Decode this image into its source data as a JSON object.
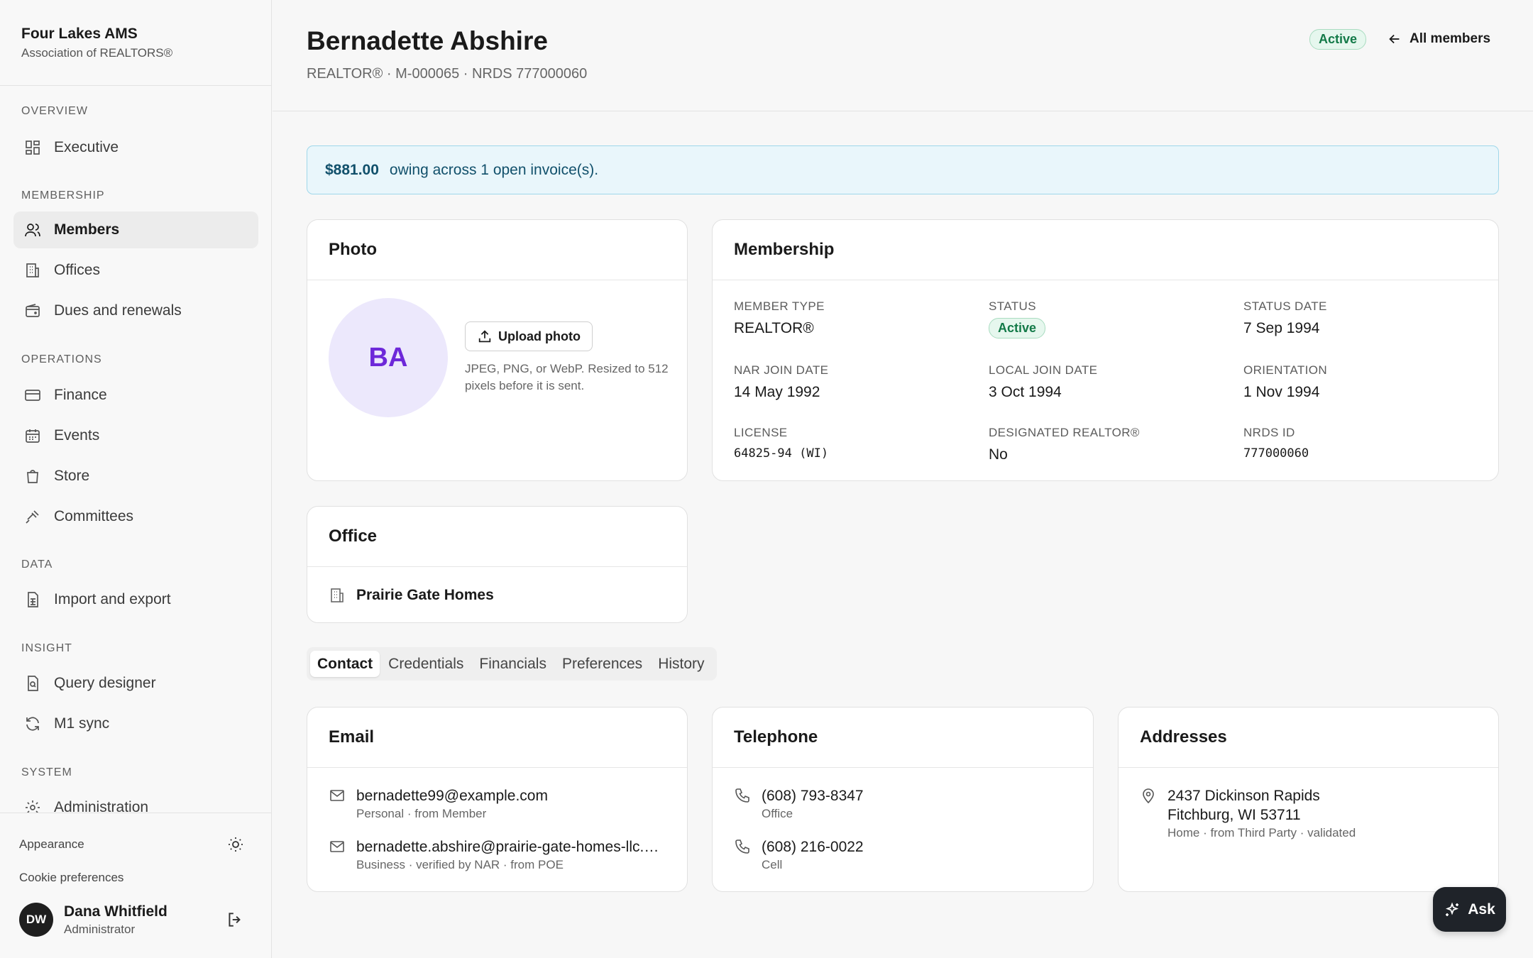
{
  "brand": {
    "name": "Four Lakes AMS",
    "sub": "Association of REALTORS®"
  },
  "nav": {
    "sections": {
      "overview": "OVERVIEW",
      "membership": "MEMBERSHIP",
      "operations": "OPERATIONS",
      "data": "DATA",
      "insight": "INSIGHT",
      "system": "SYSTEM"
    },
    "items": {
      "executive": "Executive",
      "members": "Members",
      "offices": "Offices",
      "dues": "Dues and renewals",
      "finance": "Finance",
      "events": "Events",
      "store": "Store",
      "committees": "Committees",
      "import_export": "Import and export",
      "query_designer": "Query designer",
      "m1_sync": "M1 sync",
      "administration": "Administration"
    }
  },
  "sidebar_footer": {
    "appearance": "Appearance",
    "cookie": "Cookie preferences",
    "user_initials": "DW",
    "user_name": "Dana Whitfield",
    "user_role": "Administrator"
  },
  "header": {
    "title": "Bernadette Abshire",
    "subtitle": "REALTOR® · M-000065 · NRDS 777000060",
    "status_badge": "Active",
    "back_label": "All members"
  },
  "alert": {
    "amount": "$881.00",
    "text": "owing across 1 open invoice(s)."
  },
  "photo_card": {
    "title": "Photo",
    "initials": "BA",
    "upload_label": "Upload photo",
    "hint": "JPEG, PNG, or WebP. Resized to 512 pixels before it is sent."
  },
  "membership_card": {
    "title": "Membership",
    "member_type_label": "MEMBER TYPE",
    "member_type": "REALTOR®",
    "status_label": "STATUS",
    "status": "Active",
    "status_date_label": "STATUS DATE",
    "status_date": "7 Sep 1994",
    "nar_join_label": "NAR JOIN DATE",
    "nar_join": "14 May 1992",
    "local_join_label": "LOCAL JOIN DATE",
    "local_join": "3 Oct 1994",
    "orientation_label": "ORIENTATION",
    "orientation": "1 Nov 1994",
    "license_label": "LICENSE",
    "license": "64825-94 (WI)",
    "designated_label": "DESIGNATED REALTOR®",
    "designated": "No",
    "nrds_label": "NRDS ID",
    "nrds": "777000060"
  },
  "office_card": {
    "title": "Office",
    "office_name": "Prairie Gate Homes"
  },
  "tabs": [
    "Contact",
    "Credentials",
    "Financials",
    "Preferences",
    "History"
  ],
  "email_card": {
    "title": "Email",
    "items": [
      {
        "value": "bernadette99@example.com",
        "meta": "Personal · from Member"
      },
      {
        "value": "bernadette.abshire@prairie-gate-homes-llc.example.com",
        "meta": "Business · verified by NAR · from POE"
      }
    ]
  },
  "phone_card": {
    "title": "Telephone",
    "items": [
      {
        "value": "(608) 793-8347",
        "meta": "Office"
      },
      {
        "value": "(608) 216-0022",
        "meta": "Cell"
      }
    ]
  },
  "address_card": {
    "title": "Addresses",
    "line1": "2437 Dickinson Rapids",
    "line2": "Fitchburg, WI 53711",
    "meta": "Home · from Third Party · validated"
  },
  "ask_label": "Ask",
  "colors": {
    "accent_purple": "#6d28d9",
    "active_green": "#137a48",
    "alert_bg": "#e9f6fb"
  }
}
